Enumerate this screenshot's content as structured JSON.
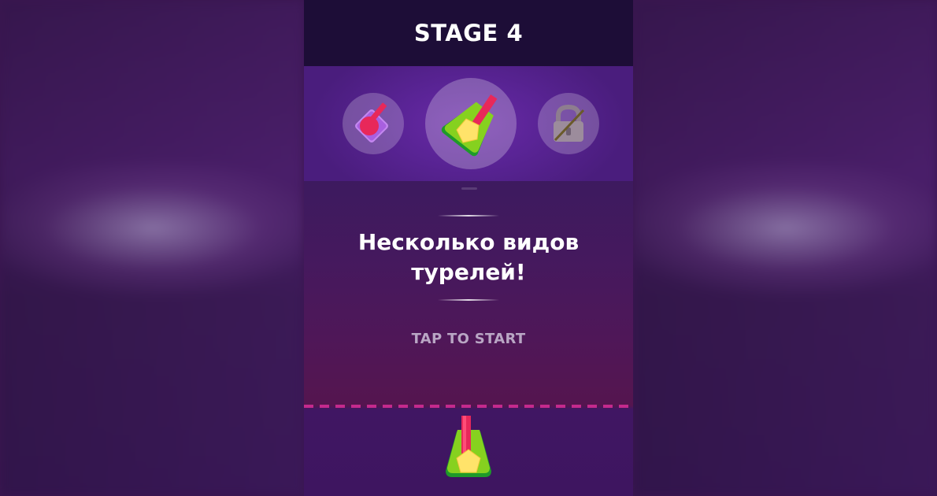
{
  "header": {
    "stage_title": "STAGE 4"
  },
  "turret_selector": {
    "items": [
      {
        "name": "round-turret",
        "state": "unlocked",
        "icon": "round-turret-icon"
      },
      {
        "name": "pentagon-turret",
        "state": "selected",
        "icon": "pentagon-turret-icon"
      },
      {
        "name": "locked-turret",
        "state": "locked",
        "icon": "lock-icon"
      }
    ]
  },
  "message": {
    "line1": "Несколько видов",
    "line2": "турелей!"
  },
  "prompt": {
    "tap_to_start": "TAP TO START"
  },
  "colors": {
    "header_bg": "#1d0d37",
    "strip_bg": "#5a2496",
    "dash_line": "#c42a8d",
    "turret_pink": "#e8285a",
    "turret_green": "#7ccc1e",
    "turret_yellow": "#ffe36a"
  }
}
